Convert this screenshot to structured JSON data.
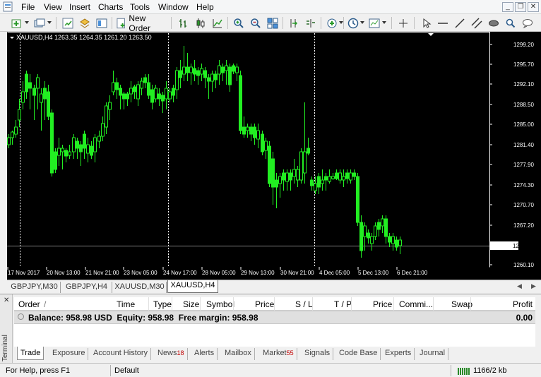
{
  "menu": [
    "File",
    "View",
    "Insert",
    "Charts",
    "Tools",
    "Window",
    "Help"
  ],
  "toolbar": {
    "new_order_label": "New Order"
  },
  "chart": {
    "header": "XAUUSD,H4",
    "ohlc": "1263.35 1264.35 1261.20 1263.50",
    "price_labels": [
      "1299.20",
      "1295.70",
      "1292.10",
      "1288.50",
      "1285.00",
      "1281.40",
      "1277.90",
      "1274.30",
      "1270.70",
      "1267.20",
      "1260.10"
    ],
    "current_price": "1263.50",
    "date_labels": [
      "17 Nov 2017",
      "20 Nov 13:00",
      "21 Nov 21:00",
      "23 Nov 05:00",
      "24 Nov 17:00",
      "28 Nov 05:00",
      "29 Nov 13:00",
      "30 Nov 21:00",
      "4 Dec 05:00",
      "5 Dec 13:00",
      "6 Dec 21:00"
    ],
    "colors": {
      "background": "#000000",
      "candle": "#22ee22",
      "grid": "#ffffff",
      "axis_text": "#ffffff"
    }
  },
  "chart_tabs": [
    "GBPJPY,M30",
    "GBPJPY,H4",
    "XAUUSD,M30",
    "XAUUSD,H4"
  ],
  "terminal": {
    "label": "Terminal",
    "columns": [
      "Order",
      "/",
      "Time",
      "Type",
      "Size",
      "Symbol",
      "Price",
      "S / L",
      "T / P",
      "Price",
      "Commi...",
      "Swap",
      "Profit"
    ],
    "balance": "Balance: 958.98 USD  Equity: 958.98  Free margin: 958.98",
    "profit": "0.00",
    "tabs": [
      "Trade",
      "Exposure",
      "Account History",
      "News",
      "Alerts",
      "Mailbox",
      "Market",
      "Signals",
      "Code Base",
      "Experts",
      "Journal"
    ],
    "news_badge": "18",
    "market_badge": "55"
  },
  "status": {
    "help": "For Help, press F1",
    "profile": "Default",
    "traffic": "1166/2 kb"
  }
}
